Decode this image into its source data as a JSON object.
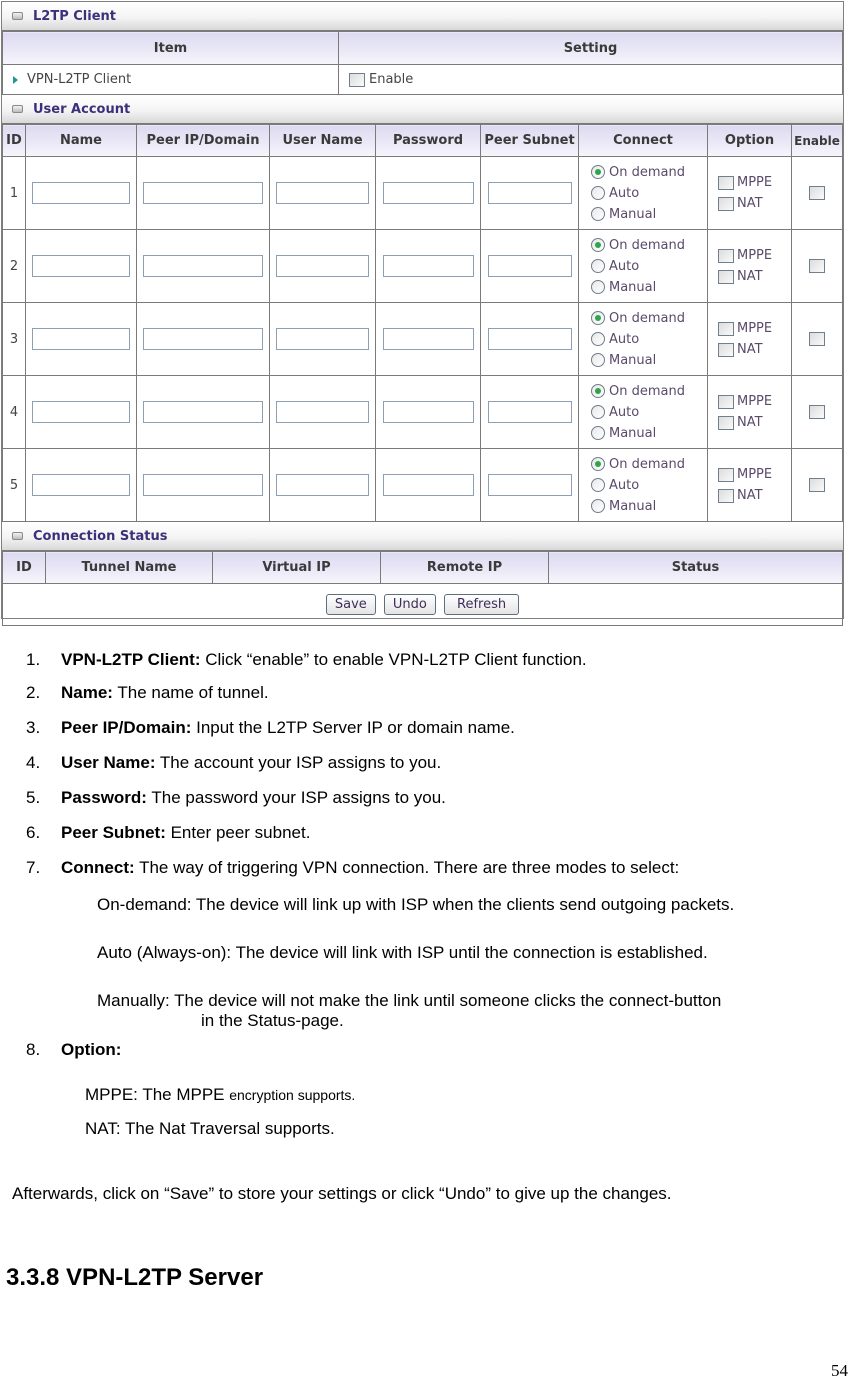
{
  "ui": {
    "client_section": {
      "title": "L2TP Client",
      "col_item": "Item",
      "col_setting": "Setting",
      "row_label": "VPN-L2TP Client",
      "enable_label": "Enable",
      "enabled": false
    },
    "user_section": {
      "title": "User Account",
      "columns": [
        "ID",
        "Name",
        "Peer IP/Domain",
        "User Name",
        "Password",
        "Peer Subnet",
        "Connect",
        "Option",
        "Enable"
      ],
      "connect_options": [
        "On demand",
        "Auto",
        "Manual"
      ],
      "option_labels": [
        "MPPE",
        "NAT"
      ],
      "rows": [
        {
          "id": "1",
          "name": "",
          "peer": "",
          "user": "",
          "password": "",
          "subnet": "",
          "connect": "On demand",
          "mppe": false,
          "nat": false,
          "enable": false
        },
        {
          "id": "2",
          "name": "",
          "peer": "",
          "user": "",
          "password": "",
          "subnet": "",
          "connect": "On demand",
          "mppe": false,
          "nat": false,
          "enable": false
        },
        {
          "id": "3",
          "name": "",
          "peer": "",
          "user": "",
          "password": "",
          "subnet": "",
          "connect": "On demand",
          "mppe": false,
          "nat": false,
          "enable": false
        },
        {
          "id": "4",
          "name": "",
          "peer": "",
          "user": "",
          "password": "",
          "subnet": "",
          "connect": "On demand",
          "mppe": false,
          "nat": false,
          "enable": false
        },
        {
          "id": "5",
          "name": "",
          "peer": "",
          "user": "",
          "password": "",
          "subnet": "",
          "connect": "On demand",
          "mppe": false,
          "nat": false,
          "enable": false
        }
      ]
    },
    "status_section": {
      "title": "Connection Status",
      "columns": [
        "ID",
        "Tunnel Name",
        "Virtual IP",
        "Remote IP",
        "Status"
      ]
    },
    "buttons": {
      "save": "Save",
      "undo": "Undo",
      "refresh": "Refresh"
    }
  },
  "doc": {
    "items": [
      {
        "num": "1.",
        "term": "VPN-L2TP Client:",
        "text": " Click “enable” to enable VPN-L2TP Client function."
      },
      {
        "num": "2.",
        "term": "Name:",
        "text": " The name of tunnel."
      },
      {
        "num": "3.",
        "term": "Peer IP/Domain:",
        "text": " Input the L2TP Server IP or domain name."
      },
      {
        "num": "4.",
        "term": "User Name:",
        "text": " The account your ISP assigns to you."
      },
      {
        "num": "5.",
        "term": "Password:",
        "text": " The password your ISP assigns to you."
      },
      {
        "num": "6.",
        "term": "Peer Subnet:",
        "text": " Enter peer subnet."
      },
      {
        "num": "7.",
        "term": "Connect:",
        "text": " The way of triggering VPN connection. There are three modes to select:"
      },
      {
        "num": "8.",
        "term": "Option:",
        "text": ""
      }
    ],
    "connect_modes": {
      "on_demand": "On-demand: The device will link up with ISP when the clients send outgoing packets.",
      "auto": "Auto (Always-on): The device will link with ISP until the connection is established.",
      "manual_line1": "Manually: The device will not make the link until someone clicks the connect-button",
      "manual_line2": "in the Status-page."
    },
    "options": {
      "mppe_prefix": "MPPE: The MPPE ",
      "mppe_suffix": "encryption supports.",
      "nat": "NAT: The Nat Traversal supports."
    },
    "afterwards": "Afterwards, click on “Save” to store your settings or click “Undo” to give up the changes.",
    "section_heading": "3.3.8 VPN-L2TP Server",
    "page_number": "54"
  }
}
